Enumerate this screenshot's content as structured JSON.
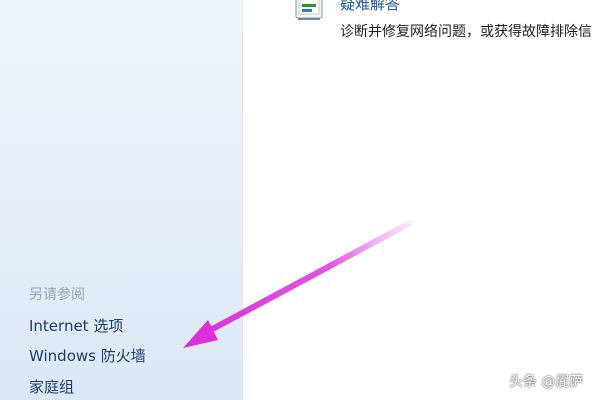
{
  "colors": {
    "sidebar_bg": "#e6eff9",
    "link": "#1a3d6e",
    "heading_muted": "#9aa4ae",
    "task_link": "#1e5aa8",
    "arrow": "#e040e0"
  },
  "troubleshoot": {
    "icon": "troubleshoot-icon",
    "title": "疑难解答",
    "description": "诊断并修复网络问题，或获得故障排除信"
  },
  "sidebar": {
    "see_also_heading": "另请参阅",
    "links": [
      {
        "label": "Internet 选项"
      },
      {
        "label": "Windows 防火墙"
      },
      {
        "label": "家庭组"
      }
    ]
  },
  "annotation": {
    "type": "arrow",
    "points_to": "Windows 防火墙"
  },
  "watermark": "头条 @屁萨"
}
